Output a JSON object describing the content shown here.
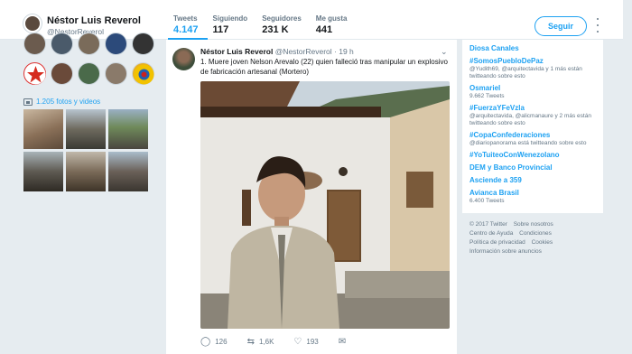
{
  "profile": {
    "name": "Néstor Luis Reverol",
    "handle": "@NestorReverol"
  },
  "stats": [
    {
      "label": "Tweets",
      "value": "4.147",
      "active": true
    },
    {
      "label": "Siguiendo",
      "value": "117"
    },
    {
      "label": "Seguidores",
      "value": "231 K"
    },
    {
      "label": "Me gusta",
      "value": "441"
    }
  ],
  "follow_label": "Seguir",
  "media": {
    "photos_label": "1.205 fotos y videos"
  },
  "tweet": {
    "author": "Néstor Luis Reverol",
    "handle": "@NestorReverol",
    "separator": "·",
    "time": "19 h",
    "text": "1. Muere joven Nelson Arevalo (22) quien falleció tras manipular un explosivo de fabricación artesanal (Mortero)",
    "replies": "126",
    "retweets": "1,6K",
    "likes": "193"
  },
  "trends": [
    {
      "name": "Diosa Canales",
      "desc": ""
    },
    {
      "name": "#SomosPuebloDePaz",
      "desc": "@Yudith69, @arquitectavida y 1 más están twitteando sobre esto"
    },
    {
      "name": "Osmariel",
      "desc": "9.662 Tweets"
    },
    {
      "name": "#FuerzaYFeVzla",
      "desc": "@arquitectavida, @alicmanaure y 2 más están twitteando sobre esto"
    },
    {
      "name": "#CopaConfederaciones",
      "desc": "@diariopanorama está twitteando sobre esto"
    },
    {
      "name": "#YoTuiteoConWenezolano",
      "desc": ""
    },
    {
      "name": "DEM y Banco Provincial",
      "desc": ""
    },
    {
      "name": "Asciende a 359",
      "desc": ""
    },
    {
      "name": "Avianca Brasil",
      "desc": "6.400 Tweets"
    }
  ],
  "footer": {
    "line1": [
      "© 2017 Twitter",
      "Sobre nosotros"
    ],
    "line2": [
      "Centro de Ayuda",
      "Condiciones"
    ],
    "line3": [
      "Política de privacidad",
      "Cookies"
    ],
    "line4": [
      "Información sobre anuncios"
    ]
  },
  "colors": {
    "accent": "#1da1f2",
    "background": "#e6ecf0",
    "muted_text": "#657786"
  },
  "icons": [
    "reply-icon",
    "retweet-icon",
    "like-icon",
    "message-icon",
    "chevron-down-icon",
    "photo-icon",
    "more-icon"
  ]
}
